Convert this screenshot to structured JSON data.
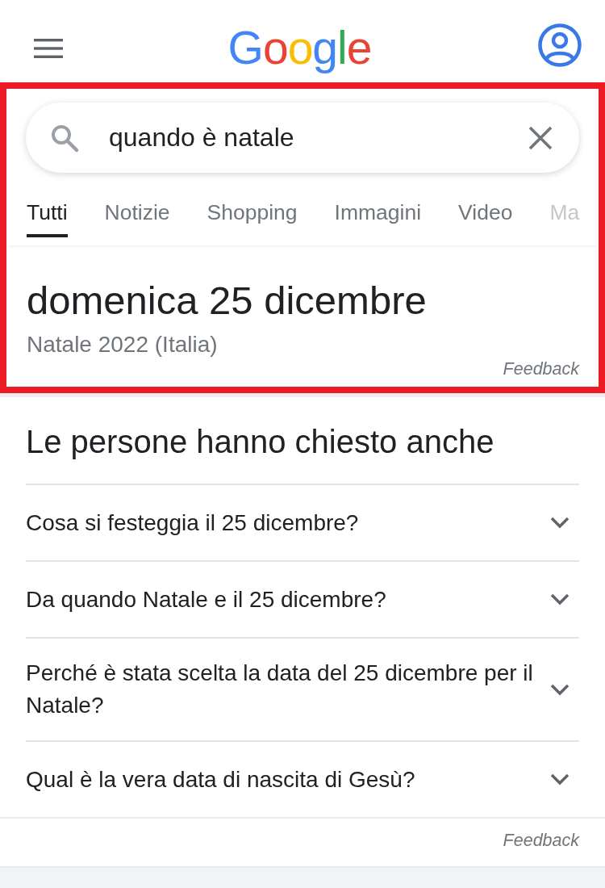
{
  "header": {
    "logo": "Google"
  },
  "search": {
    "query": "quando è natale"
  },
  "tabs": [
    {
      "label": "Tutti",
      "selected": true
    },
    {
      "label": "Notizie",
      "selected": false
    },
    {
      "label": "Shopping",
      "selected": false
    },
    {
      "label": "Immagini",
      "selected": false
    },
    {
      "label": "Video",
      "selected": false
    },
    {
      "label": "Ma",
      "selected": false
    }
  ],
  "answer": {
    "title": "domenica 25 dicembre",
    "subtitle": "Natale 2022 (Italia)",
    "feedback": "Feedback"
  },
  "related_questions": {
    "title": "Le persone hanno chiesto anche",
    "items": [
      {
        "question": "Cosa si festeggia il 25 dicembre?",
        "expanded": false
      },
      {
        "question": "Da quando Natale e il 25 dicembre?",
        "expanded": false
      },
      {
        "question": "Perché è stata scelta la data del 25 dicembre per il Natale?",
        "expanded": false
      },
      {
        "question": "Qual è la vera data di nascita di Gesù?",
        "expanded": false
      }
    ],
    "feedback": "Feedback"
  }
}
